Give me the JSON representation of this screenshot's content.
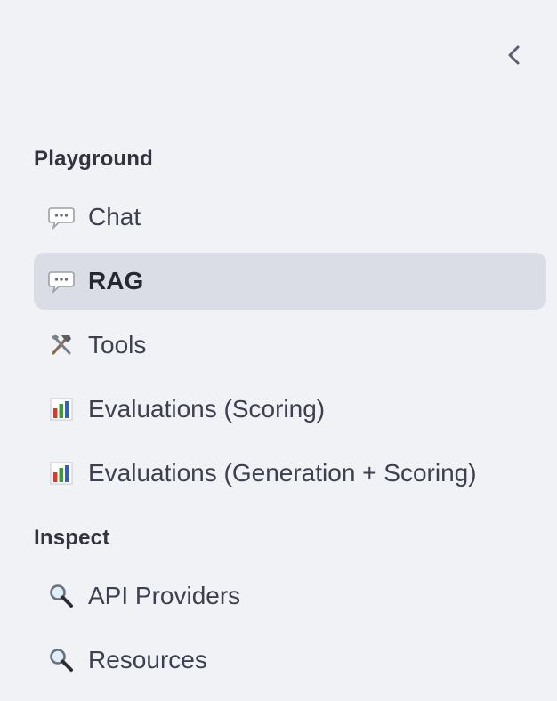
{
  "sidebar": {
    "collapse_icon": "chevron-left-icon",
    "sections": [
      {
        "header": "Playground",
        "items": [
          {
            "label": "Chat",
            "icon": "speech-bubble-icon",
            "active": false
          },
          {
            "label": "RAG",
            "icon": "speech-bubble-icon",
            "active": true
          },
          {
            "label": "Tools",
            "icon": "hammer-wrench-icon",
            "active": false
          },
          {
            "label": "Evaluations (Scoring)",
            "icon": "bar-chart-icon",
            "active": false
          },
          {
            "label": "Evaluations (Generation + Scoring)",
            "icon": "bar-chart-icon",
            "active": false
          }
        ]
      },
      {
        "header": "Inspect",
        "items": [
          {
            "label": "API Providers",
            "icon": "magnifier-icon",
            "active": false
          },
          {
            "label": "Resources",
            "icon": "magnifier-icon",
            "active": false
          }
        ]
      }
    ]
  },
  "colors": {
    "background": "#f0f2f6",
    "active_background": "#dadde5",
    "text": "#31333f"
  }
}
